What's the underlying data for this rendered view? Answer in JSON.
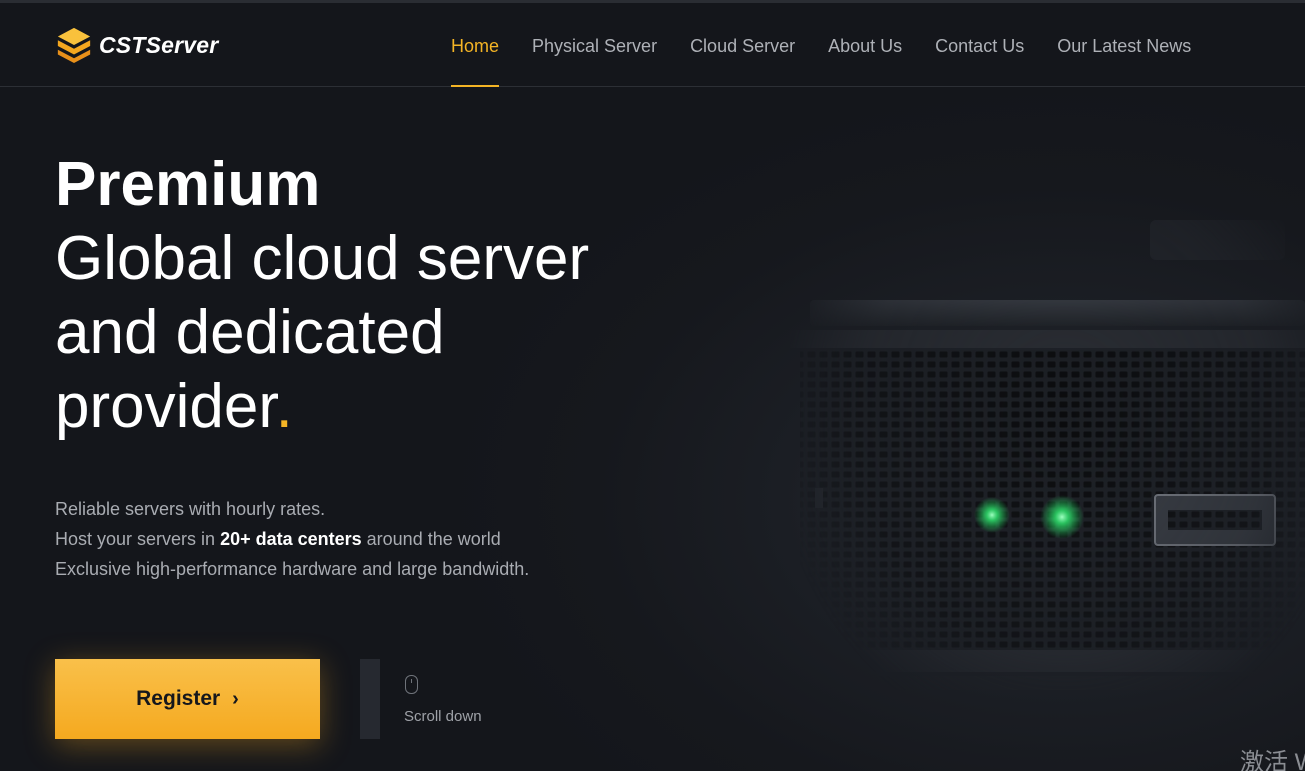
{
  "brand": {
    "name": "CSTServer",
    "accent": "#f4b425"
  },
  "nav": {
    "items": [
      {
        "label": "Home",
        "active": true
      },
      {
        "label": "Physical Server"
      },
      {
        "label": "Cloud Server"
      },
      {
        "label": "About Us"
      },
      {
        "label": "Contact Us"
      },
      {
        "label": "Our Latest News"
      }
    ]
  },
  "hero": {
    "title_bold": "Premium",
    "title_lines": [
      "Global cloud server",
      "and dedicated",
      "provider"
    ],
    "title_dot": ".",
    "subtext": {
      "line1": "Reliable servers with hourly rates.",
      "line2_pre": "Host your servers in ",
      "line2_strong": "20+ data centers",
      "line2_post": " around the world",
      "line3": "Exclusive high-performance hardware and large bandwidth."
    },
    "register_label": "Register",
    "register_chevron": "›",
    "scroll_label": "Scroll down"
  },
  "icons": {
    "logo": "logo-layers-icon",
    "register_arrow": "chevron-right-icon",
    "scroll": "mouse-icon"
  },
  "watermark": "激活 W"
}
